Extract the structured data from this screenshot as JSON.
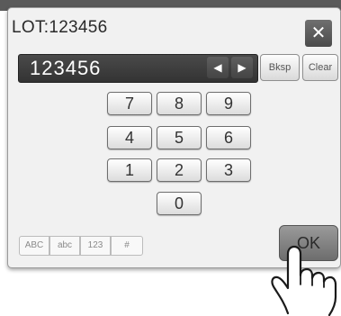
{
  "dialog": {
    "title": "LOT:123456",
    "close_label": "✕"
  },
  "entry": {
    "value": "123456"
  },
  "keys": {
    "arrow_left": "◀",
    "arrow_right": "▶",
    "bksp": "Bksp",
    "clear": "Clear",
    "digits": [
      "7",
      "8",
      "9",
      "4",
      "5",
      "6",
      "1",
      "2",
      "3",
      "0"
    ]
  },
  "modes": [
    "ABC",
    "abc",
    "123",
    "#"
  ],
  "ok_label": "OK",
  "icons": {
    "close": "close-icon",
    "arrow_left": "arrow-left-icon",
    "arrow_right": "arrow-right-icon",
    "pointer": "pointing-hand-icon"
  }
}
